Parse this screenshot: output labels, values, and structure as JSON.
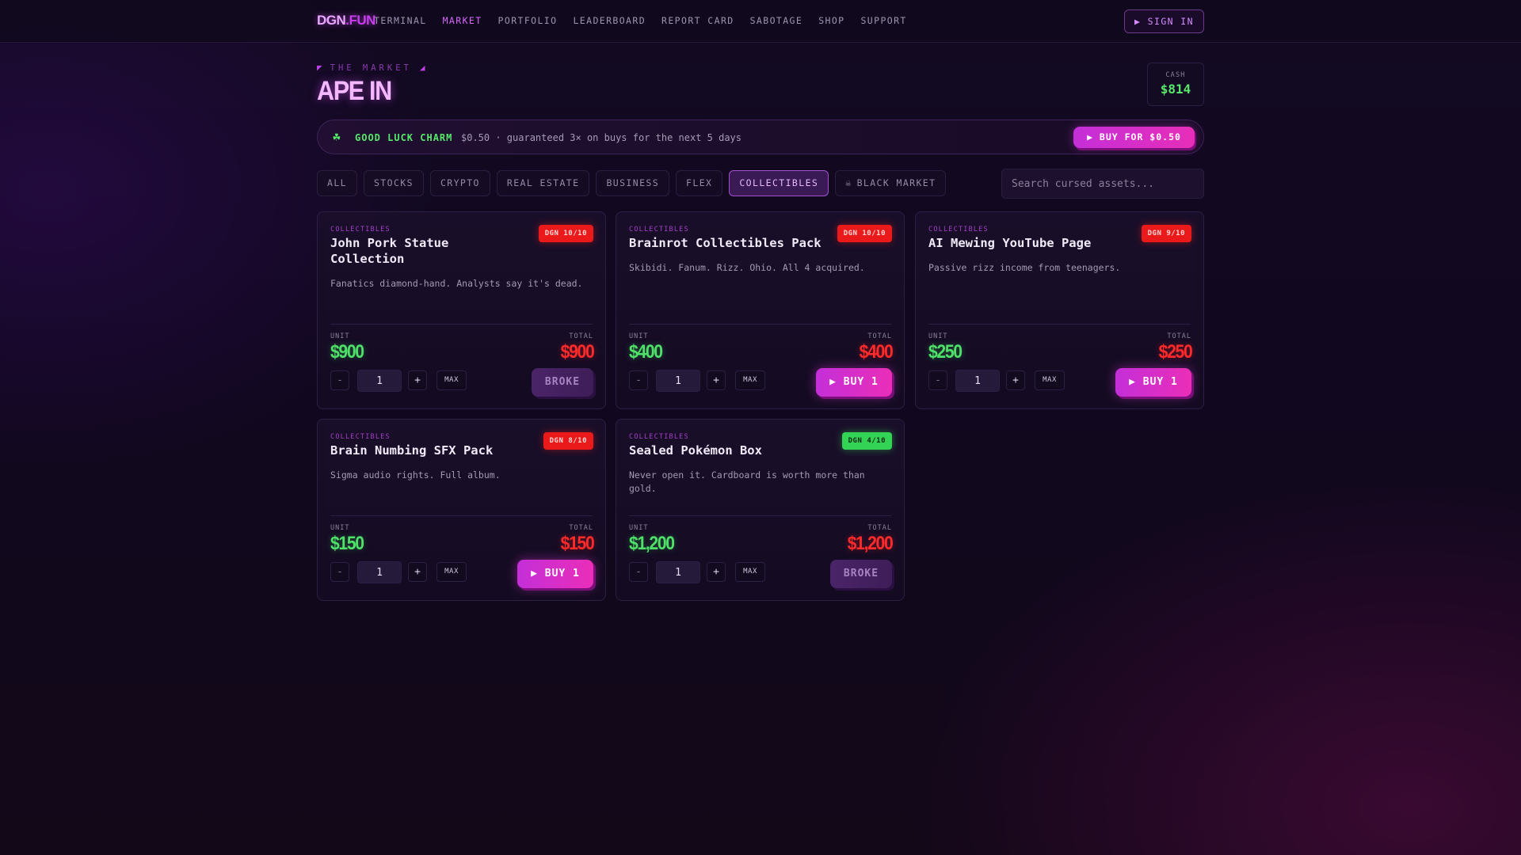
{
  "nav": {
    "logo_a": "DGN",
    "logo_b": ".FUN",
    "links": [
      "TERMINAL",
      "MARKET",
      "PORTFOLIO",
      "LEADERBOARD",
      "REPORT CARD",
      "SABOTAGE",
      "SHOP",
      "SUPPORT"
    ],
    "active": "MARKET",
    "sign_in": "▶ SIGN IN"
  },
  "header": {
    "eyebrow": "THE MARKET",
    "title": "APE IN",
    "cash_label": "CASH",
    "cash_value": "$814"
  },
  "charm": {
    "icon": "clover-icon",
    "name": "GOOD LUCK CHARM",
    "desc": "$0.50 · guaranteed 3× on buys for the next 5 days",
    "button": "▶ BUY FOR $0.50"
  },
  "filters": {
    "items": [
      "ALL",
      "STOCKS",
      "CRYPTO",
      "REAL ESTATE",
      "BUSINESS",
      "FLEX",
      "COLLECTIBLES",
      "BLACK MARKET"
    ],
    "active": "COLLECTIBLES",
    "search_placeholder": "Search cursed assets..."
  },
  "labels": {
    "unit": "UNIT",
    "total": "TOTAL",
    "minus": "-",
    "plus": "+",
    "max": "MAX"
  },
  "cards": [
    {
      "category": "COLLECTIBLES",
      "name": "John Pork Statue Collection",
      "badge": "DGN 10/10",
      "badge_color": "#ea1a1a",
      "desc": "Fanatics diamond-hand. Analysts say it's dead.",
      "unit": "$900",
      "total": "$900",
      "qty": "1",
      "action": "BROKE"
    },
    {
      "category": "COLLECTIBLES",
      "name": "Brainrot Collectibles Pack",
      "badge": "DGN 10/10",
      "badge_color": "#ea1a1a",
      "desc": "Skibidi. Fanum. Rizz. Ohio. All 4 acquired.",
      "unit": "$400",
      "total": "$400",
      "qty": "1",
      "action": "▶ BUY 1"
    },
    {
      "category": "COLLECTIBLES",
      "name": "AI Mewing YouTube Page",
      "badge": "DGN 9/10",
      "badge_color": "#ea1a1a",
      "desc": "Passive rizz income from teenagers.",
      "unit": "$250",
      "total": "$250",
      "qty": "1",
      "action": "▶ BUY 1"
    },
    {
      "category": "COLLECTIBLES",
      "name": "Brain Numbing SFX Pack",
      "badge": "DGN 8/10",
      "badge_color": "#ea1a1a",
      "desc": "Sigma audio rights. Full album.",
      "unit": "$150",
      "total": "$150",
      "qty": "1",
      "action": "▶ BUY 1"
    },
    {
      "category": "COLLECTIBLES",
      "name": "Sealed Pokémon Box",
      "badge": "DGN 4/10",
      "badge_color": "#33d456",
      "desc": "Never open it. Cardboard is worth more than gold.",
      "unit": "$1,200",
      "total": "$1,200",
      "qty": "1",
      "action": "BROKE"
    }
  ]
}
